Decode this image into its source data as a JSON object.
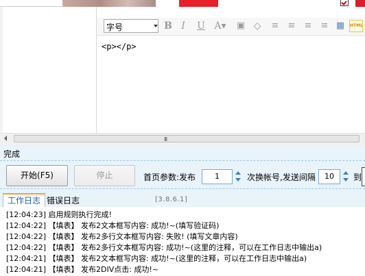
{
  "editor": {
    "fontsize_label": "字号",
    "content": "<p></p>",
    "html_button": "HTML",
    "toolbar_icons": [
      "bold-icon",
      "italic-icon",
      "underline-icon",
      "font-color-icon",
      "special-char-icon",
      "eraser-icon",
      "align-left-icon",
      "align-center-icon",
      "align-right-icon",
      "justify-icon",
      "table-icon",
      "html-icon"
    ]
  },
  "scrollbar": {
    "grip": "III"
  },
  "status": {
    "text": "完成"
  },
  "controls": {
    "start_label": "开始(F5)",
    "stop_label": "停止",
    "param_label": "首页参数:发布",
    "spin1_value": "1",
    "switch_label": "次换帐号,发送间隔",
    "spin2_value": "10",
    "to_label": "到"
  },
  "log": {
    "tab_work": "工作日志",
    "tab_error": "错误日志",
    "version": "[3.8.6.1]",
    "lines": [
      "[12:04:23] 启用规则执行完成!",
      "[12:04:22] 【填表】 发布2文本框写内容: 成功!~(填写验证码)",
      "[12:04:22] 【填表】 发布2多行文本框写内容: 失败! (填写文章内容)",
      "[12:04:22] 【填表】 发布2多行文本框写内容: 成功!~(这里的注释，可以在工作日志中输出a)",
      "[12:04:21] 【填表】 发布2文本框写内容: 成功!~(这里的注释，可以在工作日志中输出a)",
      "[12:04:21] 【填表】 发布2DIV点击: 成功!~"
    ]
  },
  "colors": {
    "accent_blue": "#1a5fa8",
    "tab_orange": "#f0a030",
    "panel_bg": "#e9f3fa"
  }
}
